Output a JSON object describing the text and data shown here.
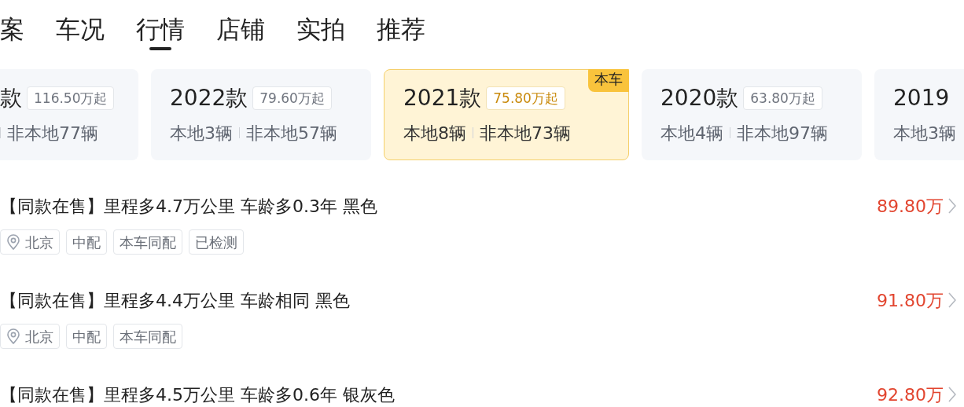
{
  "tabs": [
    {
      "label": "案",
      "selected": false
    },
    {
      "label": "车况",
      "selected": false
    },
    {
      "label": "行情",
      "selected": true
    },
    {
      "label": "店铺",
      "selected": false
    },
    {
      "label": "实拍",
      "selected": false
    },
    {
      "label": "推荐",
      "selected": false
    }
  ],
  "years": [
    {
      "title": "款",
      "price": "116.50万起",
      "nonlocal": "非本地77辆",
      "selected": false,
      "kind": "first"
    },
    {
      "title": "2022款",
      "price": "79.60万起",
      "local": "本地3辆",
      "nonlocal": "非本地57辆",
      "selected": false,
      "kind": "middle"
    },
    {
      "title": "2021款",
      "price": "75.80万起",
      "local": "本地8辆",
      "nonlocal": "非本地73辆",
      "selected": true,
      "badge": "本车",
      "kind": "middle"
    },
    {
      "title": "2020款",
      "price": "63.80万起",
      "local": "本地4辆",
      "nonlocal": "非本地97辆",
      "selected": false,
      "kind": "middle"
    },
    {
      "title": "2019",
      "local": "本地3辆",
      "selected": false,
      "kind": "last"
    }
  ],
  "listings": [
    {
      "title": "【同款在售】里程多4.7万公里 车龄多0.3年 黑色",
      "price": "89.80万",
      "tags": [
        {
          "label": "北京",
          "kind": "location"
        },
        {
          "label": "中配",
          "kind": "plain"
        },
        {
          "label": "本车同配",
          "kind": "plain"
        },
        {
          "label": "已检测",
          "kind": "plain"
        }
      ]
    },
    {
      "title": "【同款在售】里程多4.4万公里 车龄相同 黑色",
      "price": "91.80万",
      "tags": [
        {
          "label": "北京",
          "kind": "location"
        },
        {
          "label": "中配",
          "kind": "plain"
        },
        {
          "label": "本车同配",
          "kind": "plain"
        }
      ]
    },
    {
      "title": "【同款在售】里程多4.5万公里 车龄多0.6年 银灰色",
      "price": "92.80万"
    }
  ]
}
